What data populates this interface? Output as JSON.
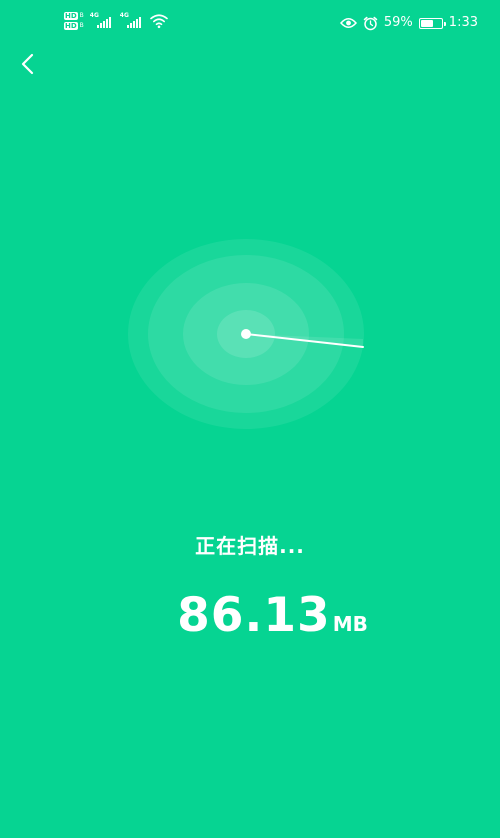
{
  "status_bar": {
    "sim_badge": "HD",
    "sim_sub": "B",
    "network_1": "4G",
    "network_2": "4G",
    "battery_percent": "59%",
    "battery_level": 0.59,
    "time": "1:33",
    "icons": [
      "hd-badge-icon",
      "signal-icon",
      "wifi-icon",
      "eye-icon",
      "alarm-icon",
      "battery-icon"
    ]
  },
  "header": {
    "back_icon": "chevron-left-icon"
  },
  "scan": {
    "status": "正在扫描...",
    "size_value": "86.13",
    "size_unit": "MB",
    "radar_icon": "radar-icon"
  },
  "colors": {
    "background": "#06d492",
    "foreground": "#ffffff"
  }
}
